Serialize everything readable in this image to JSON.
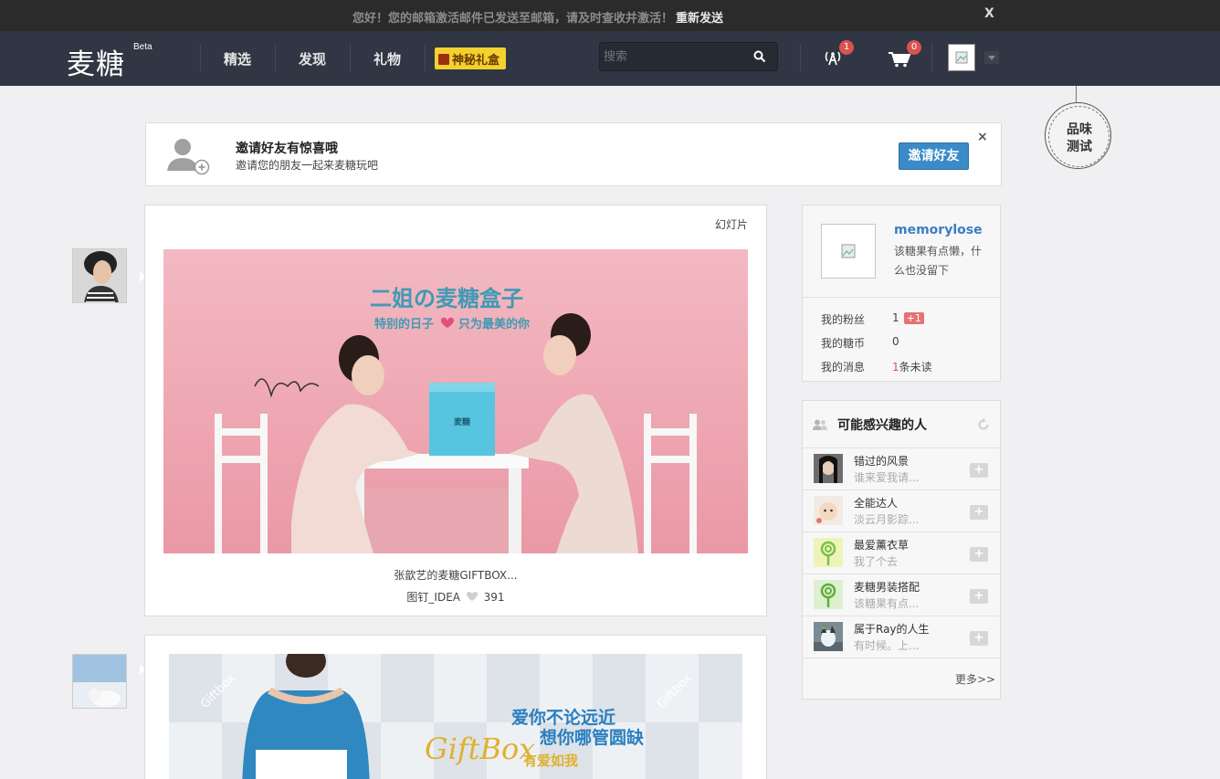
{
  "notice": {
    "message": "您好！您的邮箱激活邮件已发送至邮箱，请及时查收并激活！",
    "resend_label": "重新发送",
    "close_label": "X"
  },
  "header": {
    "logo": "麦糖",
    "beta": "Beta",
    "nav": [
      "精选",
      "发现",
      "礼物"
    ],
    "mystery_box": "神秘礼盒",
    "search_placeholder": "搜索",
    "notif_count": "1",
    "cart_count": "0"
  },
  "tag": {
    "line1": "品味",
    "line2": "测试"
  },
  "invite": {
    "title": "邀请好友有惊喜哦",
    "desc": "邀请您的朋友一起来麦糖玩吧",
    "button": "邀请好友",
    "close": "×"
  },
  "posts": [
    {
      "type": "幻灯片",
      "banner_title": "二姐の麦糖盒子",
      "banner_subtitle_a": "特别的日子",
      "banner_subtitle_b": "只为最美的你",
      "box_brand": "麦糖",
      "caption": "张歆艺的麦糖GIFTBOX...",
      "author": "图钉_IDEA",
      "likes": "391"
    },
    {
      "banner_brand": "GiftBox",
      "banner_line1": "爱你不论远近",
      "banner_line2": "想你哪管圆缺",
      "banner_line3": "有爱如我",
      "watermark": "Giftbox"
    }
  ],
  "profile": {
    "username": "memorylose",
    "bio": "该糖果有点懒，什么也没留下",
    "stats": [
      {
        "label": "我的粉丝",
        "value": "1",
        "badge": "+1"
      },
      {
        "label": "我的糖币",
        "value": "0"
      },
      {
        "label": "我的消息",
        "count": "1",
        "suffix": "条未读"
      }
    ]
  },
  "suggest": {
    "title": "可能感兴趣的人",
    "people": [
      {
        "name": "错过的风景",
        "desc": "谁来爱我请...",
        "add": "+"
      },
      {
        "name": "全能达人",
        "desc": "淡云月影踪...",
        "add": "+"
      },
      {
        "name": "最爱薰衣草",
        "desc": "我了个去",
        "add": "+"
      },
      {
        "name": "麦糖男装搭配",
        "desc": "该糖果有点...",
        "add": "+"
      },
      {
        "name": "属于Ray的人生",
        "desc": "有时候。上...",
        "add": "+"
      }
    ],
    "more": "更多>>"
  },
  "colors": {
    "header_bg": "#303643",
    "link_blue": "#3a7ec6",
    "invite_btn": "#3a8bc8",
    "badge_red": "#d9534f"
  }
}
